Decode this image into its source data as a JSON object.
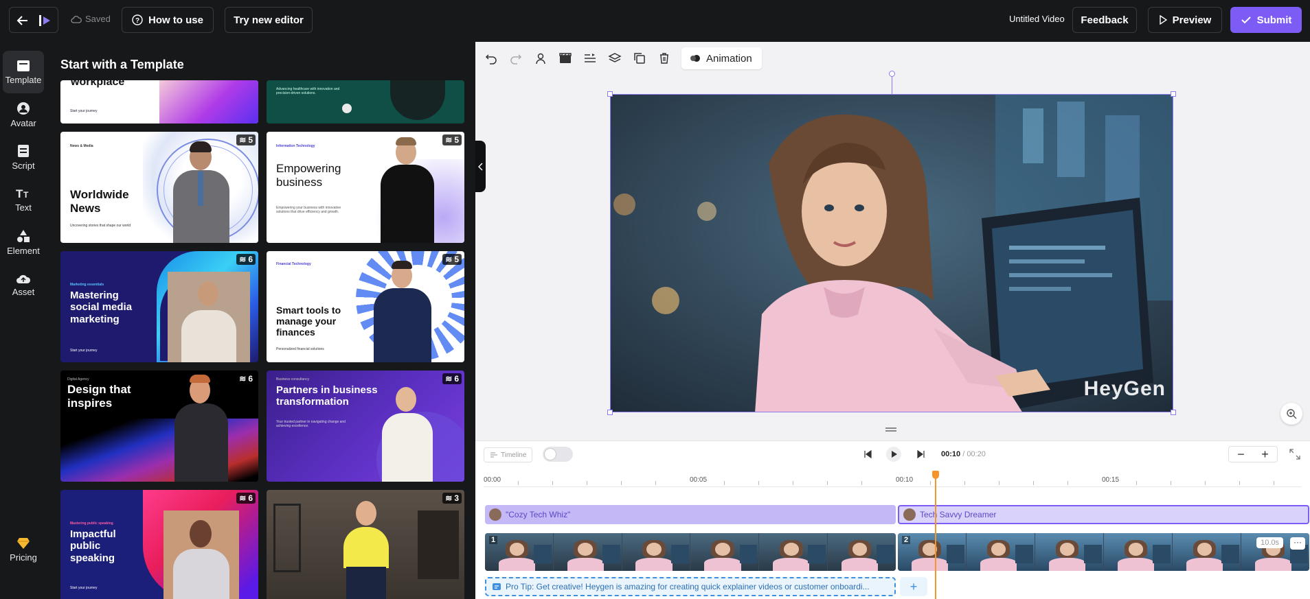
{
  "topbar": {
    "saved": "Saved",
    "how_to_use": "How to use",
    "try_new_editor": "Try new editor",
    "video_title": "Untitled Video",
    "feedback": "Feedback",
    "preview": "Preview",
    "submit": "Submit",
    "accent": "#7c5cf5"
  },
  "rail": {
    "items": [
      {
        "label": "Template",
        "icon": "template-icon"
      },
      {
        "label": "Avatar",
        "icon": "avatar-icon"
      },
      {
        "label": "Script",
        "icon": "script-icon"
      },
      {
        "label": "Text",
        "icon": "text-icon"
      },
      {
        "label": "Element",
        "icon": "element-icon"
      },
      {
        "label": "Asset",
        "icon": "cloud-icon"
      }
    ],
    "pricing": "Pricing"
  },
  "panel": {
    "title": "Start with a Template",
    "cards": [
      {
        "title": "workplace",
        "sub": "Start your journey"
      },
      {
        "title": "",
        "sub": "Advancing healthcare with innovation and precision-driven solutions."
      },
      {
        "title": "Worldwide News",
        "tag": "News & Media",
        "sub": "Uncovering stories that shape our world",
        "count": "5"
      },
      {
        "title": "Empowering business",
        "tag": "Information Technology",
        "sub": "Empowering your business with innovative solutions that drive efficiency and growth.",
        "count": "5"
      },
      {
        "title": "Mastering social media marketing",
        "tag": "Marketing essentials",
        "sub": "Start your journey",
        "count": "6"
      },
      {
        "title": "Smart tools to manage your finances",
        "tag": "Financial Technology",
        "sub": "Personalized financial solutions",
        "count": "5"
      },
      {
        "title": "Design that inspires",
        "tag": "Digital Agency",
        "count": "6"
      },
      {
        "title": "Partners in business transformation",
        "tag": "Business consultancy",
        "sub": "Your trusted partner in navigating change and achieving excellence.",
        "count": "6"
      },
      {
        "title": "Impactful public speaking",
        "tag": "Mastering public speaking",
        "sub": "Start your journey",
        "count": "6"
      },
      {
        "title": "",
        "count": "3"
      }
    ]
  },
  "editor": {
    "animation": "Animation",
    "watermark": "HeyGen"
  },
  "timeline": {
    "toggle_label": "Timeline",
    "current_time": "00:10",
    "total_time": "/ 00:20",
    "ticks": [
      "00:00",
      "00:05",
      "00:10",
      "00:15"
    ],
    "scene1": "\"Cozy Tech Whiz\"",
    "scene2": "Tech Savvy Dreamer",
    "scene1_num": "1",
    "scene2_num": "2",
    "scene2_duration": "10.0s",
    "tip": "Pro Tip: Get creative! Heygen is amazing for creating quick explainer videos or customer onboardi...",
    "playhead_color": "#f5942a",
    "scene1_color": "#c4b8f7",
    "scene2_color": "#d9d2fb"
  }
}
